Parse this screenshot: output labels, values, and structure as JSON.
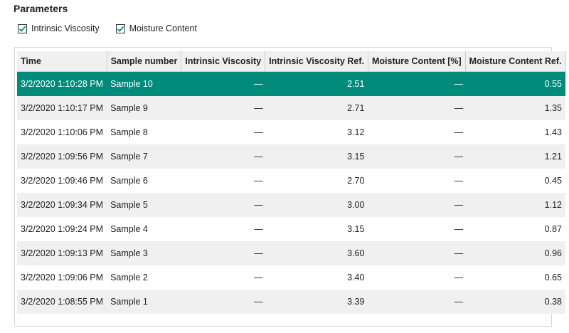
{
  "parameters": {
    "title": "Parameters",
    "options": [
      {
        "label": "Intrinsic Viscosity",
        "checked": true
      },
      {
        "label": "Moisture Content",
        "checked": true
      }
    ]
  },
  "table": {
    "columns": [
      "Time",
      "Sample number",
      "Intrinsic Viscosity",
      "Intrinsic Viscosity Ref.",
      "Moisture Content [%]",
      "Moisture Content Ref."
    ],
    "rows": [
      {
        "time": "3/2/2020 1:10:28 PM",
        "sample": "Sample 10",
        "iv": "—",
        "iv_ref": "2.51",
        "mc": "—",
        "mc_ref": "0.55"
      },
      {
        "time": "3/2/2020 1:10:17 PM",
        "sample": "Sample 9",
        "iv": "—",
        "iv_ref": "2.71",
        "mc": "—",
        "mc_ref": "1.35"
      },
      {
        "time": "3/2/2020 1:10:06 PM",
        "sample": "Sample 8",
        "iv": "—",
        "iv_ref": "3.12",
        "mc": "—",
        "mc_ref": "1.43"
      },
      {
        "time": "3/2/2020 1:09:56 PM",
        "sample": "Sample 7",
        "iv": "—",
        "iv_ref": "3.15",
        "mc": "—",
        "mc_ref": "1.21"
      },
      {
        "time": "3/2/2020 1:09:46 PM",
        "sample": "Sample 6",
        "iv": "—",
        "iv_ref": "2.70",
        "mc": "—",
        "mc_ref": "0.45"
      },
      {
        "time": "3/2/2020 1:09:34 PM",
        "sample": "Sample 5",
        "iv": "—",
        "iv_ref": "3.00",
        "mc": "—",
        "mc_ref": "1.12"
      },
      {
        "time": "3/2/2020 1:09:24 PM",
        "sample": "Sample 4",
        "iv": "—",
        "iv_ref": "3.15",
        "mc": "—",
        "mc_ref": "0.87"
      },
      {
        "time": "3/2/2020 1:09:13 PM",
        "sample": "Sample 3",
        "iv": "—",
        "iv_ref": "3.60",
        "mc": "—",
        "mc_ref": "0.96"
      },
      {
        "time": "3/2/2020 1:09:06 PM",
        "sample": "Sample 2",
        "iv": "—",
        "iv_ref": "3.40",
        "mc": "—",
        "mc_ref": "0.65"
      },
      {
        "time": "3/2/2020 1:08:55 PM",
        "sample": "Sample 1",
        "iv": "—",
        "iv_ref": "3.39",
        "mc": "—",
        "mc_ref": "0.38"
      }
    ],
    "selected_row": 0
  },
  "colors": {
    "selection": "#008a7a",
    "checkmark": "#008a7a",
    "alt_row": "#f0f0f0"
  },
  "icons": [
    "checkbox-checked-icon"
  ]
}
